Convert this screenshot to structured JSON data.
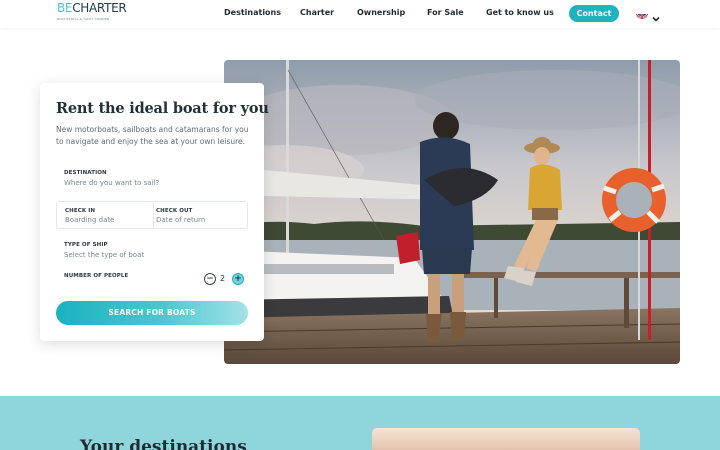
{
  "brand": {
    "logo_part1": "BE",
    "logo_part2": "CHARTER",
    "tagline": "BOAT RENTAL & YACHT CHARTER"
  },
  "nav": {
    "items": [
      {
        "label": "Destinations"
      },
      {
        "label": "Charter"
      },
      {
        "label": "Ownership"
      },
      {
        "label": "For Sale"
      },
      {
        "label": "Get to know us"
      }
    ],
    "contact_label": "Contact",
    "language_icon": "uk-flag-icon"
  },
  "search_card": {
    "title": "Rent the ideal boat for you",
    "subtitle": "New motorboats, sailboats and catamarans for you to navigate and enjoy the sea at your own leisure.",
    "destination": {
      "label": "DESTINATION",
      "placeholder": "Where do you want to sail?"
    },
    "check_in": {
      "label": "CHECK IN",
      "placeholder": "Boarding date"
    },
    "check_out": {
      "label": "CHECK OUT",
      "placeholder": "Date of return"
    },
    "ship_type": {
      "label": "TYPE OF SHIP",
      "placeholder": "Select the type of boat"
    },
    "people": {
      "label": "NUMBER OF PEOPLE",
      "value": "2",
      "minus": "−",
      "plus": "+"
    },
    "search_label": "SEARCH FOR BOATS"
  },
  "destinations": {
    "title": "Your destinations"
  },
  "colors": {
    "accent": "#1eb3c0",
    "band": "#8ed5dc",
    "text_dark": "#1f2b33"
  }
}
